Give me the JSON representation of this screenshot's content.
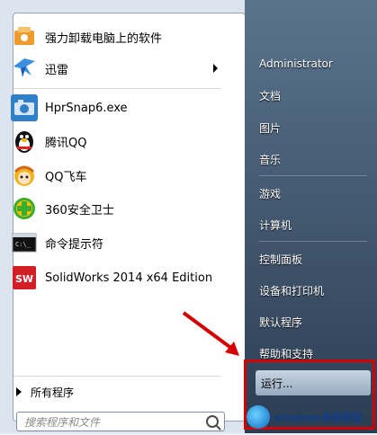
{
  "left_menu": {
    "items": [
      {
        "label": "强力卸载电脑上的软件",
        "icon": "uninstall-box-icon",
        "color": "#f09a2c"
      },
      {
        "label": "迅雷",
        "icon": "thunder-bird-icon",
        "color": "#3b8fe0"
      },
      {
        "label": "HprSnap6.exe",
        "icon": "camera-snap-icon",
        "color": "#2f80c8"
      },
      {
        "label": "腾讯QQ",
        "icon": "qq-penguin-icon",
        "color": "#000000"
      },
      {
        "label": "QQ飞车",
        "icon": "qq-racing-character-icon",
        "color": "#f3b31c"
      },
      {
        "label": "360安全卫士",
        "icon": "360-shield-plus-icon",
        "color": "#3cad2e"
      },
      {
        "label": "命令提示符",
        "icon": "command-prompt-icon",
        "color": "#111111"
      },
      {
        "label": "SolidWorks 2014 x64 Edition",
        "icon": "solidworks-sw-icon",
        "color": "#d21f26"
      }
    ],
    "all_programs": "所有程序",
    "search_placeholder": "搜索程序和文件"
  },
  "right_menu": {
    "items": [
      {
        "label": "Administrator"
      },
      {
        "label": "文档"
      },
      {
        "label": "图片"
      },
      {
        "label": "音乐"
      },
      {
        "label": "游戏"
      },
      {
        "label": "计算机"
      },
      {
        "label": "控制面板"
      },
      {
        "label": "设备和打印机"
      },
      {
        "label": "默认程序"
      },
      {
        "label": "帮助和支持"
      },
      {
        "label": "运行..."
      }
    ]
  },
  "watermark": {
    "text": "windows系统家园"
  },
  "colors": {
    "highlight": "#d40000"
  }
}
